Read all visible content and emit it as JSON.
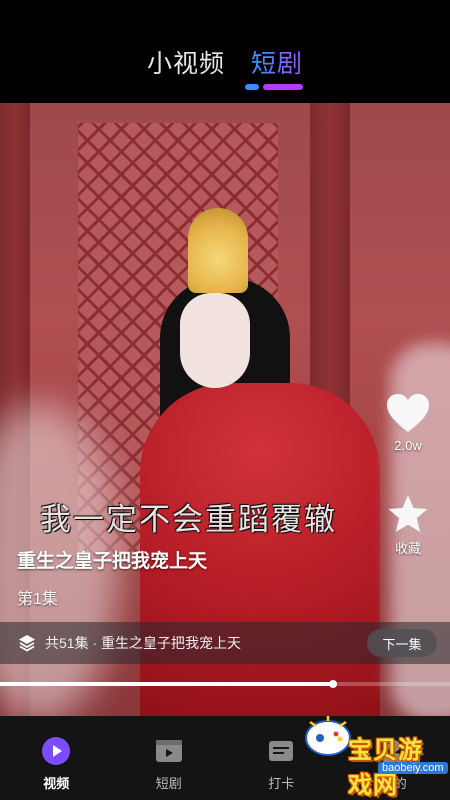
{
  "header": {
    "tabs": [
      {
        "label": "小视频",
        "active": false
      },
      {
        "label": "短剧",
        "active": true
      }
    ]
  },
  "video": {
    "subtitle": "我一定不会重蹈覆辙",
    "title": "重生之皇子把我宠上天",
    "episode": "第1集",
    "progress_fraction": 0.74
  },
  "actions": {
    "like_count": "2.0w",
    "collect_label": "收藏"
  },
  "series": {
    "info": "共51集 · 重生之皇子把我宠上天",
    "next_label": "下一集"
  },
  "nav": {
    "items": [
      {
        "label": "视频",
        "icon": "play-circle-icon",
        "active": true
      },
      {
        "label": "短剧",
        "icon": "film-icon",
        "active": false
      },
      {
        "label": "打卡",
        "icon": "checkin-icon",
        "active": false
      },
      {
        "label": "我的",
        "icon": "user-icon",
        "active": false
      }
    ]
  },
  "watermark": {
    "text": "宝贝游戏网",
    "url": "baobeiy.com"
  },
  "colors": {
    "accent_blue": "#2f9bff",
    "accent_purple": "#a54bff",
    "nav_bg": "#141414"
  }
}
